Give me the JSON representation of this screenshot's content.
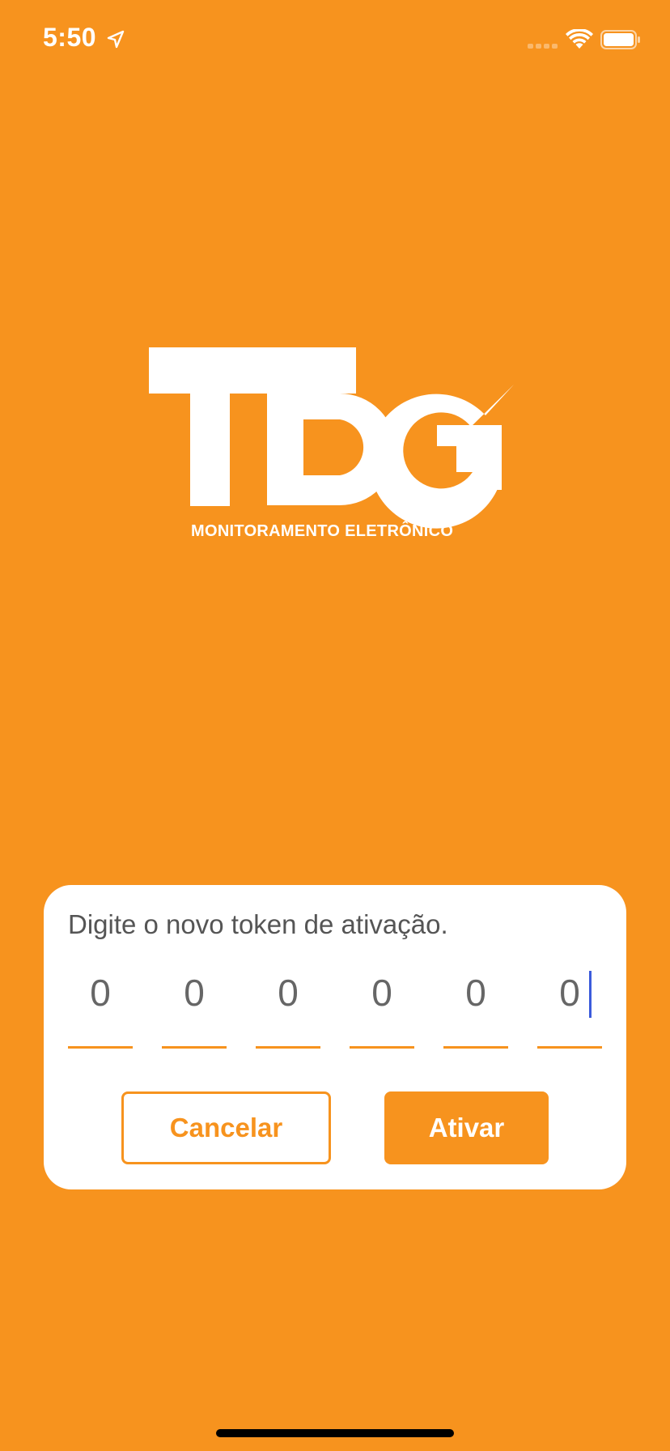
{
  "status_bar": {
    "time": "5:50",
    "icons": [
      "location-arrow-icon",
      "cellular-signal-icon",
      "wifi-icon",
      "battery-icon"
    ]
  },
  "logo": {
    "name": "TDG",
    "subtitle": "MONITORAMENTO ELETRÔNICO"
  },
  "dialog": {
    "message": "Digite o novo token de ativação.",
    "token_digits": [
      "0",
      "0",
      "0",
      "0",
      "0",
      "0"
    ],
    "cancel_label": "Cancelar",
    "activate_label": "Ativar"
  },
  "colors": {
    "background": "#F7931E",
    "accent": "#F7931E",
    "card": "#FFFFFF",
    "caret": "#3B5BDB"
  }
}
